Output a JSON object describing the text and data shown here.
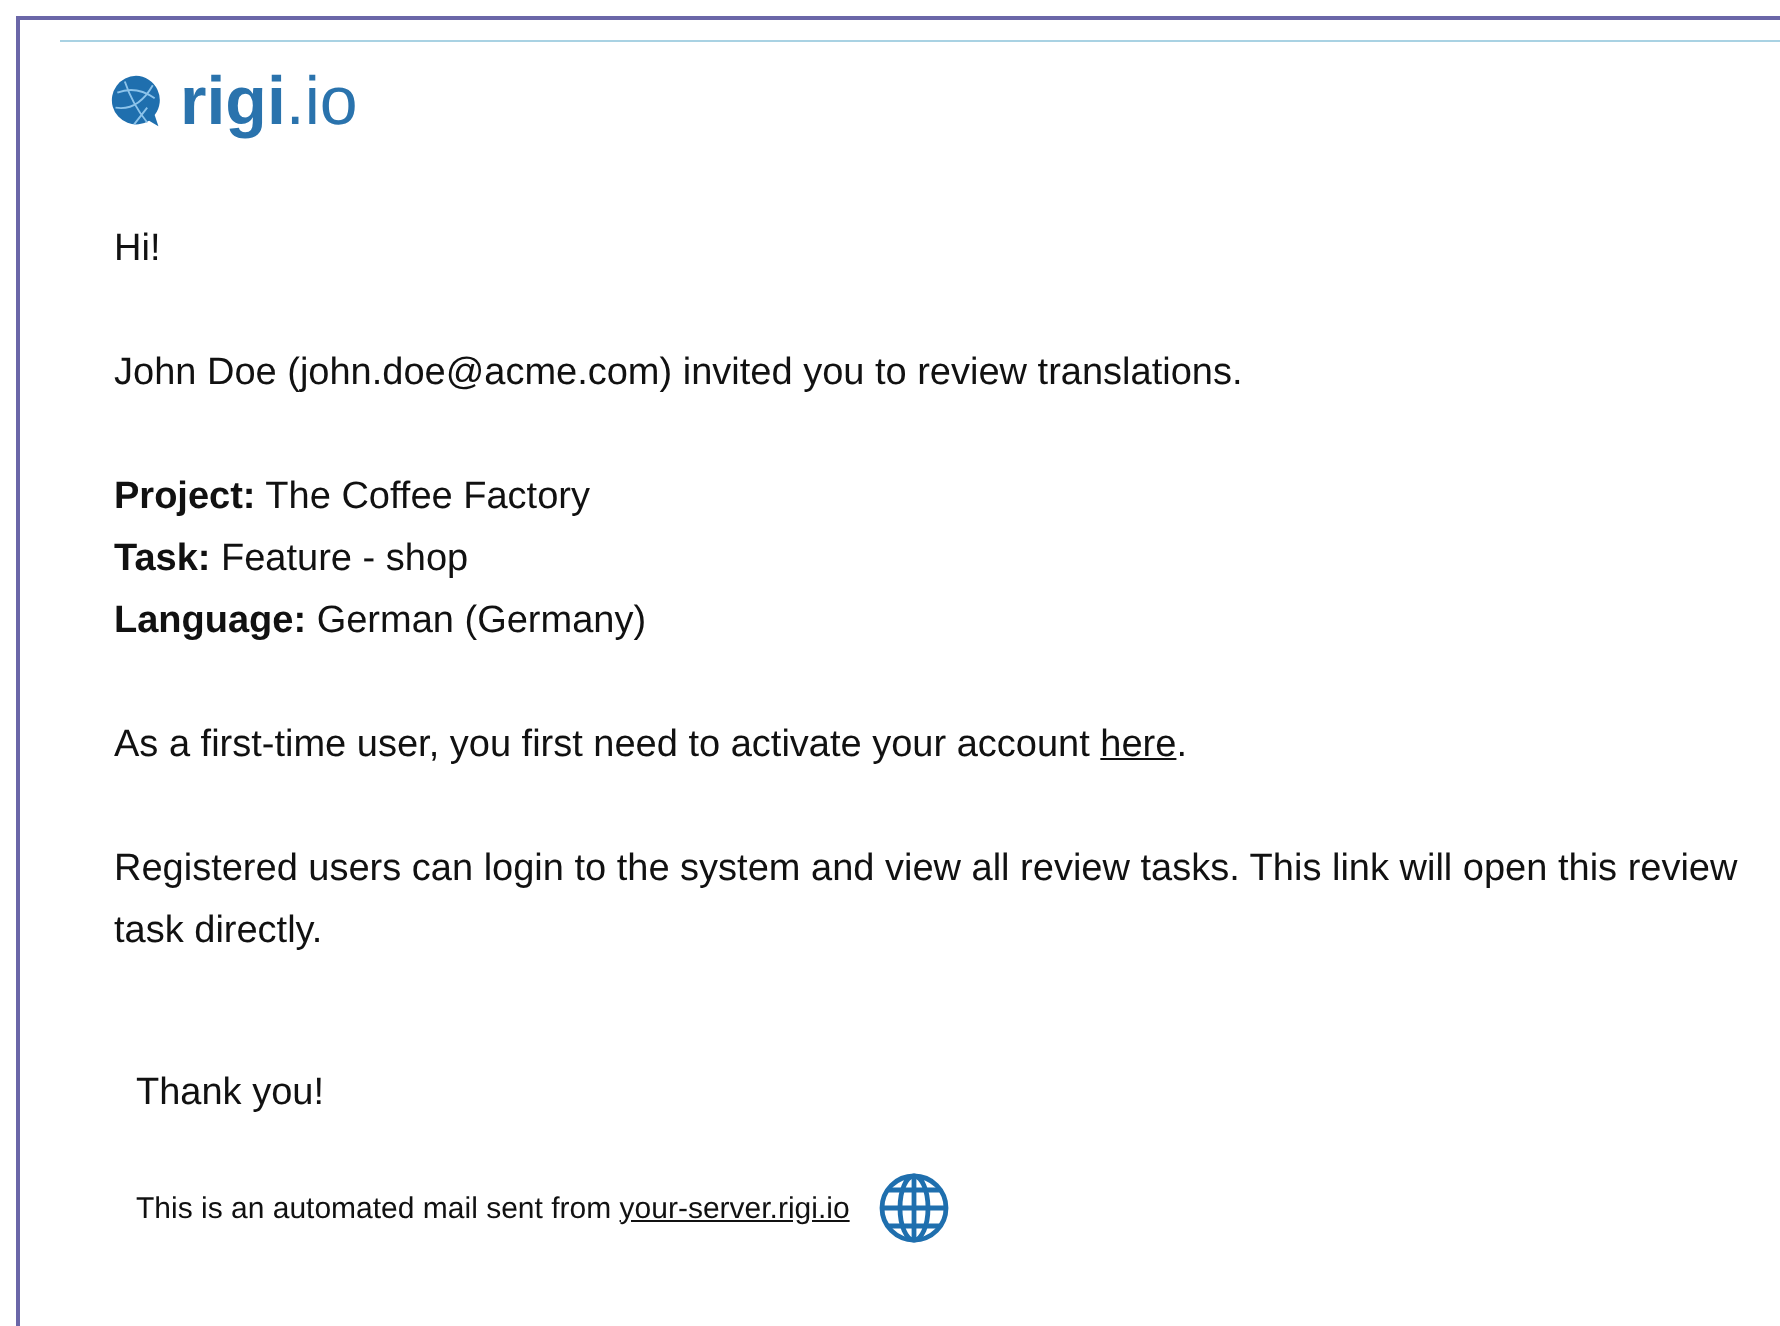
{
  "logo": {
    "text": "**rigi**.io"
  },
  "greeting": "Hi!",
  "intro": "John Doe (john.doe@acme.com) invited you to review translations.",
  "details": [
    {
      "text": "**Project:** The Coffee Factory"
    },
    {
      "text": "**Task:** Feature - shop"
    },
    {
      "text": "**Language:** German (Germany)"
    }
  ],
  "activation": {
    "before": "As a first-time user, you first need to activate your account ",
    "link": "here",
    "after": "."
  },
  "registered_note": "Registered users can login to the system and view all review tasks. This link will open this review task directly.",
  "closing": "Thank you!",
  "footer": {
    "before": "This is an automated mail sent from ",
    "link": "your-server.rigi.io"
  }
}
